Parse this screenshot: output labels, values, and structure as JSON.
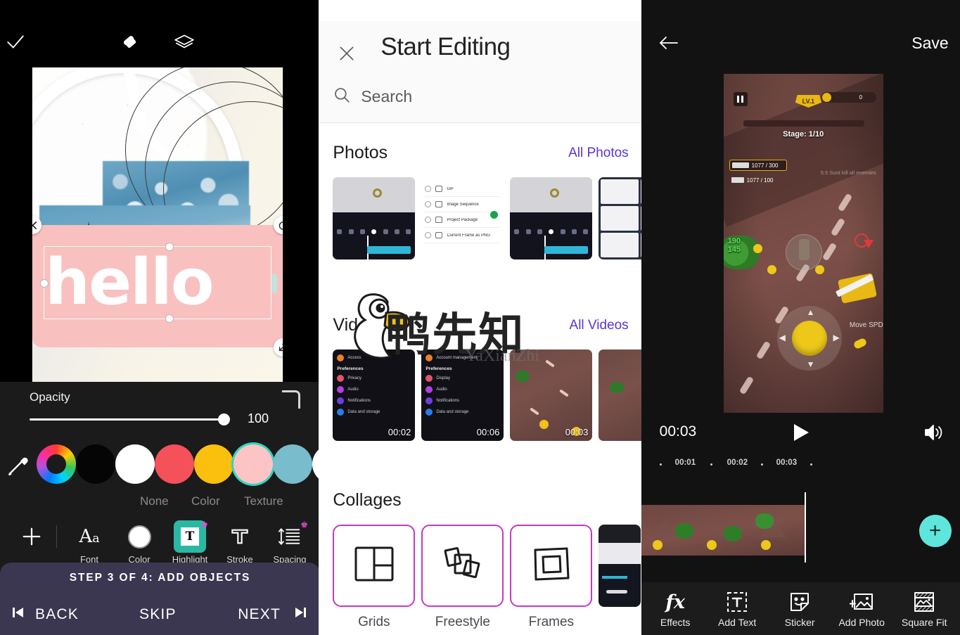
{
  "panel_editor": {
    "topbar": {
      "close_icon": "close-icon",
      "eraser_icon": "eraser-icon",
      "layers_icon": "layers-icon",
      "confirm_icon": "check-icon"
    },
    "canvas": {
      "text_object": "hello"
    },
    "opacity": {
      "label": "Opacity",
      "value": "100"
    },
    "swatches": [
      {
        "name": "eyedropper",
        "color": "#ffffff"
      },
      {
        "name": "color-wheel",
        "color": "rainbow"
      },
      {
        "name": "black",
        "color": "#000000"
      },
      {
        "name": "white",
        "color": "#ffffff"
      },
      {
        "name": "red",
        "color": "#f4515b"
      },
      {
        "name": "yellow",
        "color": "#fbc00e"
      },
      {
        "name": "pink",
        "color": "#fcc4c4"
      },
      {
        "name": "teal-blue",
        "color": "#79bccc"
      },
      {
        "name": "white-2",
        "color": "#ffffff"
      }
    ],
    "selected_swatch_color": "#fcc4c4",
    "fill_tabs": [
      "None",
      "Color",
      "Texture"
    ],
    "tools": [
      {
        "label": "",
        "icon": "plus-icon",
        "premium": false,
        "selected": false
      },
      {
        "label": "Font",
        "icon": "font-icon",
        "premium": false,
        "selected": false
      },
      {
        "label": "Color",
        "icon": "color-circle-icon",
        "premium": false,
        "selected": false
      },
      {
        "label": "Highlight",
        "icon": "highlight-icon",
        "premium": true,
        "selected": true
      },
      {
        "label": "Stroke",
        "icon": "stroke-icon",
        "premium": false,
        "selected": false
      },
      {
        "label": "Spacing",
        "icon": "spacing-icon",
        "premium": true,
        "selected": false
      }
    ],
    "step_banner": "STEP 3 OF 4: ADD OBJECTS",
    "nav": {
      "back": "BACK",
      "skip": "SKIP",
      "next": "NEXT"
    },
    "accent_color": "#2bb8a3",
    "banner_color": "#3b3750"
  },
  "panel_picker": {
    "close_icon": "close-icon",
    "title": "Start Editing",
    "search": {
      "icon": "search-icon",
      "placeholder": "Search",
      "value": ""
    },
    "sections": [
      {
        "title": "Photos",
        "link": "All Photos"
      },
      {
        "title": "Videos",
        "link": "All Videos"
      },
      {
        "title": "Collages",
        "link": ""
      }
    ],
    "photo_thumbs": [
      {
        "name": "app-screenshot-1",
        "kind": "app"
      },
      {
        "name": "export-options-list",
        "kind": "list"
      },
      {
        "name": "app-screenshot-2",
        "kind": "app"
      },
      {
        "name": "shape-grid",
        "kind": "grid"
      }
    ],
    "export_list_items": [
      "GIF",
      "Image Sequence",
      "Project Package",
      "Current Frame as PNG"
    ],
    "video_thumbs": [
      {
        "name": "settings-menu-video-1",
        "kind": "menu",
        "duration": "00:02"
      },
      {
        "name": "settings-menu-video-2",
        "kind": "menu",
        "duration": "00:06"
      },
      {
        "name": "game-video-1",
        "kind": "game",
        "duration": "00:03"
      },
      {
        "name": "game-video-2",
        "kind": "game",
        "duration": ""
      }
    ],
    "menu_thumb_1": {
      "header": "Access",
      "group": "Preferences",
      "items": [
        "Privacy",
        "Audio",
        "Notifications",
        "Data and storage"
      ]
    },
    "menu_thumb_2": {
      "header": "Account management",
      "group": "Preferences",
      "items": [
        "Display",
        "Audio",
        "Notifications",
        "Data and storage"
      ]
    },
    "collages": [
      {
        "label": "Grids",
        "icon": "grid-layout-icon"
      },
      {
        "label": "Freestyle",
        "icon": "stacked-cards-icon"
      },
      {
        "label": "Frames",
        "icon": "frame-icon"
      }
    ],
    "link_color": "#5b33d6",
    "collage_border_color": "#c538c7",
    "watermark": {
      "mascot": "duck-mascot",
      "text_cn": "鸭先知",
      "text_sub": "YaXianZhi"
    }
  },
  "panel_video": {
    "back_icon": "arrow-left-icon",
    "save_label": "Save",
    "preview": {
      "pause_icon": "pause-icon",
      "level_badge": "LV.1",
      "stage_label": "Stage: 1/10",
      "coin_count": "0",
      "ammo_primary": "1077 / 300",
      "ammo_secondary": "1077 / 100",
      "hint_text": "5.5 Sunt  kill all enemies",
      "hp_text": "190\n145",
      "buff_text": "Move SPD",
      "joystick_icon": "joystick-icon"
    },
    "playback": {
      "current_time": "00:03",
      "play_icon": "play-icon",
      "volume_icon": "volume-icon"
    },
    "ruler_marks": [
      "00:01",
      "00:02",
      "00:03"
    ],
    "add_clip_icon": "plus-icon",
    "bottom_tools": [
      {
        "label": "Effects",
        "icon": "fx-icon"
      },
      {
        "label": "Add Text",
        "icon": "add-text-icon"
      },
      {
        "label": "Sticker",
        "icon": "sticker-icon"
      },
      {
        "label": "Add Photo",
        "icon": "add-photo-icon"
      },
      {
        "label": "Square Fit",
        "icon": "square-fit-icon"
      }
    ],
    "accent_color": "#5fe6dc"
  }
}
